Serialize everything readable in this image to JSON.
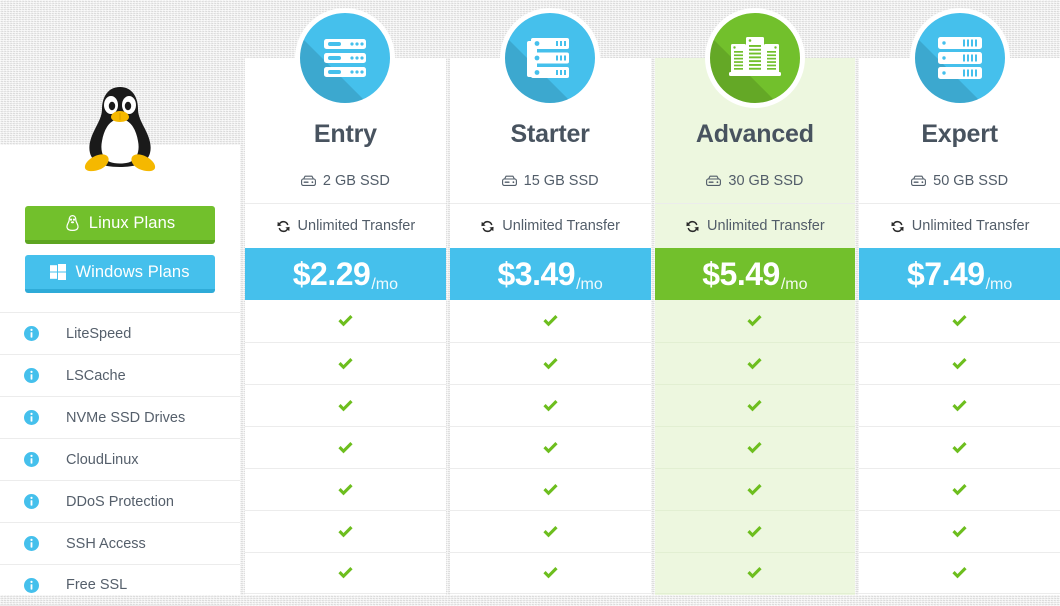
{
  "sidebar": {
    "logo_icon": "tux-penguin-logo",
    "buttons": [
      {
        "label": "Linux Plans",
        "icon": "tux-icon",
        "color": "#72c02c",
        "active": true
      },
      {
        "label": "Windows Plans",
        "icon": "windows-icon",
        "color": "#45c0ec",
        "active": false
      }
    ],
    "features": [
      {
        "label": "LiteSpeed",
        "info_icon": "info-icon"
      },
      {
        "label": "LSCache",
        "info_icon": "info-icon"
      },
      {
        "label": "NVMe SSD Drives",
        "info_icon": "info-icon"
      },
      {
        "label": "CloudLinux",
        "info_icon": "info-icon"
      },
      {
        "label": "DDoS Protection",
        "info_icon": "info-icon"
      },
      {
        "label": "SSH Access",
        "info_icon": "info-icon"
      },
      {
        "label": "Free SSL",
        "info_icon": "info-icon"
      }
    ]
  },
  "plans": [
    {
      "name": "Entry",
      "icon": "server-rack-icon",
      "storage": "2 GB SSD",
      "storage_icon": "hard-drive-icon",
      "transfer": "Unlimited Transfer",
      "transfer_icon": "sync-icon",
      "price": "$2.29",
      "period": "/mo",
      "featured": false,
      "accent": "#45c0ec",
      "checks": [
        true,
        true,
        true,
        true,
        true,
        true,
        true
      ]
    },
    {
      "name": "Starter",
      "icon": "server-stack-icon",
      "storage": "15 GB SSD",
      "storage_icon": "hard-drive-icon",
      "transfer": "Unlimited Transfer",
      "transfer_icon": "sync-icon",
      "price": "$3.49",
      "period": "/mo",
      "featured": false,
      "accent": "#45c0ec",
      "checks": [
        true,
        true,
        true,
        true,
        true,
        true,
        true
      ]
    },
    {
      "name": "Advanced",
      "icon": "server-towers-icon",
      "storage": "30 GB SSD",
      "storage_icon": "hard-drive-icon",
      "transfer": "Unlimited Transfer",
      "transfer_icon": "sync-icon",
      "price": "$5.49",
      "period": "/mo",
      "featured": true,
      "accent": "#72c02c",
      "checks": [
        true,
        true,
        true,
        true,
        true,
        true,
        true
      ]
    },
    {
      "name": "Expert",
      "icon": "server-blades-icon",
      "storage": "50 GB SSD",
      "storage_icon": "hard-drive-icon",
      "transfer": "Unlimited Transfer",
      "transfer_icon": "sync-icon",
      "price": "$7.49",
      "period": "/mo",
      "featured": false,
      "accent": "#45c0ec",
      "checks": [
        true,
        true,
        true,
        true,
        true,
        true,
        true
      ]
    }
  ],
  "colors": {
    "blue": "#45c0ec",
    "green": "#72c02c",
    "featured_bg": "#edf7df",
    "text": "#48535f",
    "check": "#6dbe1e",
    "info": "#45c0ec"
  }
}
